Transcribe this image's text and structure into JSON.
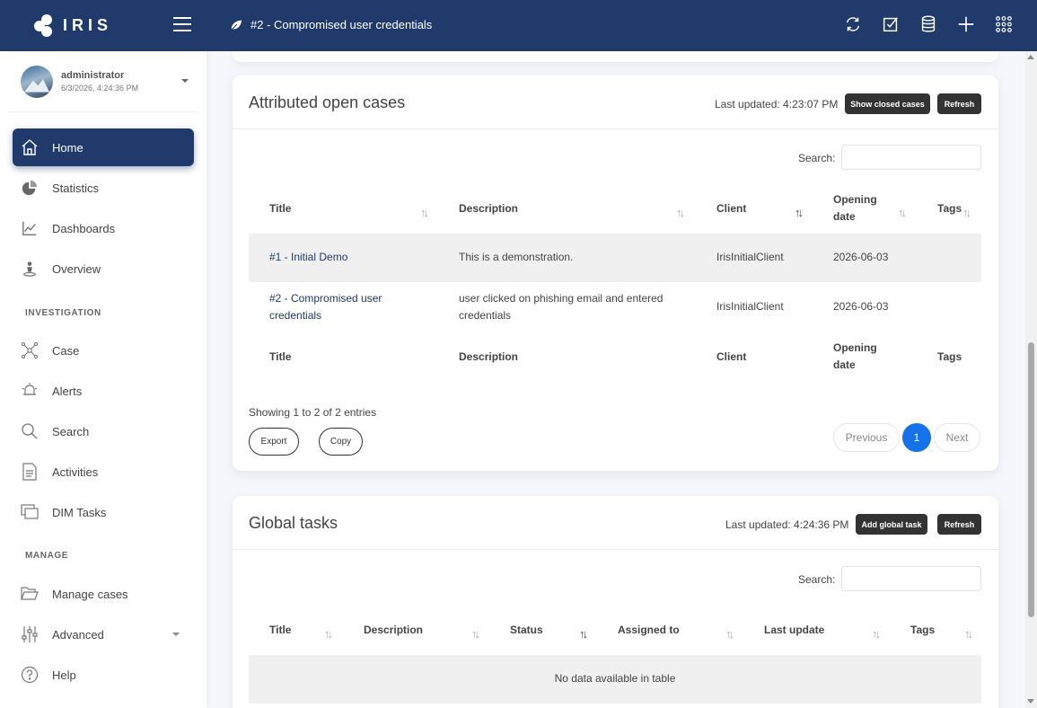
{
  "app": {
    "logo_text": "IRIS"
  },
  "header": {
    "case_title": "#2 - Compromised user credentials"
  },
  "top_icons": [
    "refresh-icon",
    "checkbox-icon",
    "database-icon",
    "plus-icon",
    "apps-grid-icon"
  ],
  "user": {
    "name": "administrator",
    "date": "6/3/2026, 4:24:36 PM"
  },
  "sidebar": {
    "home": "Home",
    "statistics": "Statistics",
    "dashboards": "Dashboards",
    "overview": "Overview",
    "section_investigation": "INVESTIGATION",
    "case": "Case",
    "alerts": "Alerts",
    "search": "Search",
    "activities": "Activities",
    "dim_tasks": "DIM Tasks",
    "section_manage": "MANAGE",
    "manage_cases": "Manage cases",
    "advanced": "Advanced",
    "help": "Help"
  },
  "open_cases": {
    "title": "Attributed open cases",
    "last_updated": "Last updated: 4:23:07 PM",
    "show_closed_label": "Show closed cases",
    "refresh_label": "Refresh",
    "search_label": "Search:",
    "columns": {
      "title": "Title",
      "description": "Description",
      "client": "Client",
      "opening_line1": "Opening",
      "opening_line2": "date",
      "tags": "Tags"
    },
    "rows": [
      {
        "title": "#1 - Initial Demo",
        "description": "This is a demonstration.",
        "client": "IrisInitialClient",
        "opening_date": "2026-06-03",
        "tags": ""
      },
      {
        "title_line1": "#2 - Compromised user",
        "title_line2": "credentials",
        "description_line1": "user clicked on phishing email and entered",
        "description_line2": "credentials",
        "client": "IrisInitialClient",
        "opening_date": "2026-06-03",
        "tags": ""
      }
    ],
    "showing": "Showing 1 to 2 of 2 entries",
    "export_label": "Export",
    "copy_label": "Copy",
    "pagination": {
      "previous": "Previous",
      "current": "1",
      "next": "Next"
    }
  },
  "global_tasks": {
    "title": "Global tasks",
    "last_updated": "Last updated: 4:24:36 PM",
    "add_label": "Add global task",
    "refresh_label": "Refresh",
    "search_label": "Search:",
    "columns": {
      "title": "Title",
      "description": "Description",
      "status": "Status",
      "assigned_to": "Assigned to",
      "last_update": "Last update",
      "tags": "Tags"
    },
    "empty_message": "No data available in table"
  },
  "colors": {
    "brand_navy": "#1f3a6b",
    "page_active": "#1572e8",
    "button_dark": "#333333"
  }
}
